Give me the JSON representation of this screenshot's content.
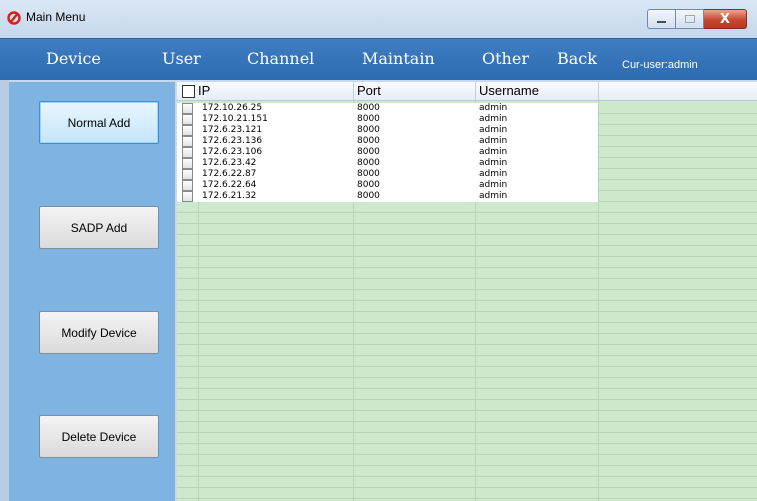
{
  "window": {
    "title": "Main Menu",
    "app_icon": "logo-icon",
    "controls": {
      "minimize": "minimize-icon",
      "maximize": "maximize-icon",
      "close_label": "X"
    }
  },
  "menu": {
    "items": [
      {
        "label": "Device"
      },
      {
        "label": "User"
      },
      {
        "label": "Channel"
      },
      {
        "label": "Maintain"
      },
      {
        "label": "Other"
      },
      {
        "label": "Back"
      }
    ],
    "current_user": "Cur-user:admin"
  },
  "actions": [
    {
      "label": "Normal Add"
    },
    {
      "label": "SADP Add"
    },
    {
      "label": "Modify Device"
    },
    {
      "label": "Delete Device"
    }
  ],
  "table": {
    "headers": {
      "ip": "IP",
      "port": "Port",
      "username": "Username"
    },
    "rows": [
      {
        "ip": "172.10.26.25",
        "port": "8000",
        "username": "admin"
      },
      {
        "ip": "172.10.21.151",
        "port": "8000",
        "username": "admin"
      },
      {
        "ip": "172.6.23.121",
        "port": "8000",
        "username": "admin"
      },
      {
        "ip": "172.6.23.136",
        "port": "8000",
        "username": "admin"
      },
      {
        "ip": "172.6.23.106",
        "port": "8000",
        "username": "admin"
      },
      {
        "ip": "172.6.23.42",
        "port": "8000",
        "username": "admin"
      },
      {
        "ip": "172.6.22.87",
        "port": "8000",
        "username": "admin"
      },
      {
        "ip": "172.6.22.64",
        "port": "8000",
        "username": "admin"
      },
      {
        "ip": "172.6.21.32",
        "port": "8000",
        "username": "admin"
      }
    ]
  },
  "colors": {
    "menubar": "#2d6ab0",
    "leftpane": "#7fb3e2",
    "grid_empty": "#cde8cd",
    "close_button": "#c7482f"
  }
}
